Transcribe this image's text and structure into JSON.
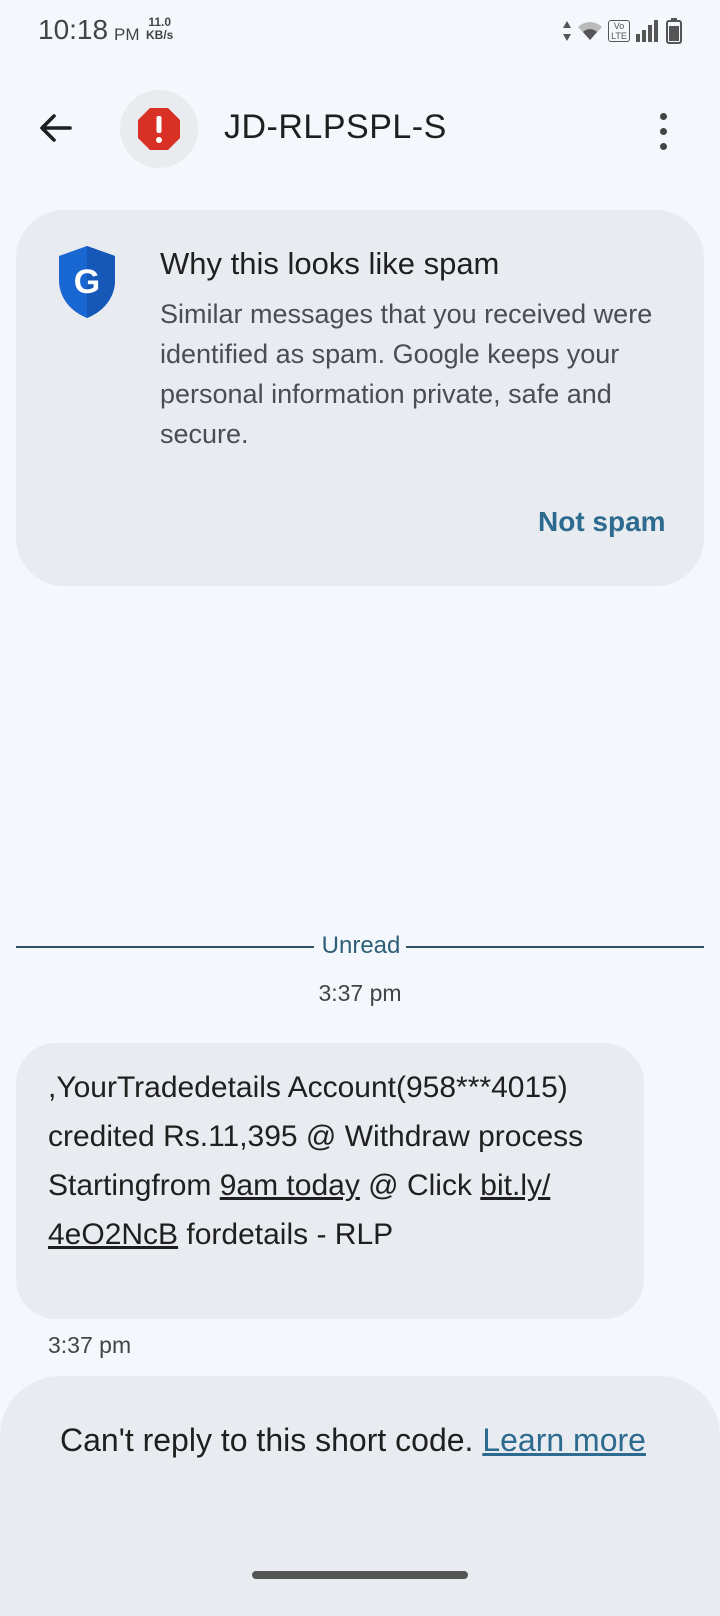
{
  "status_bar": {
    "time": "10:18",
    "ampm": "PM",
    "speed_value": "11.0",
    "speed_unit": "KB/s",
    "icons": [
      "data-arrows-icon",
      "wifi-icon",
      "volte-icon",
      "signal-icon",
      "battery-icon"
    ],
    "volte_label_top": "Vo",
    "volte_label_bottom": "LTE"
  },
  "header": {
    "contact_name": "JD-RLPSPL-S",
    "back_icon": "back-arrow-icon",
    "avatar_icon": "spam-alert-icon",
    "avatar_alert_color": "#d93025",
    "more_icon": "more-vert-icon"
  },
  "spam_card": {
    "title": "Why this looks like spam",
    "body": "Similar messages that you received were identified as spam. Google keeps your personal information private, safe and secure.",
    "shield_icon": "google-shield-icon",
    "shield_letter": "G",
    "shield_color": "#1967d2",
    "not_spam_label": "Not spam"
  },
  "conversation": {
    "unread_label": "Unread",
    "timestamp_header": "3:37 pm",
    "message": {
      "part1": ",YourTradedetails Account(958***4015) credited Rs.11,395 @ Withdraw process Startingfrom ",
      "link1": "9am today",
      "part2": " @ Click ",
      "link2": "bit.ly/\n4eO2NcB",
      "part3": " fordetails - RLP",
      "time": "3:37 pm"
    }
  },
  "footer": {
    "reply_text": "Can't reply to this short code. ",
    "learn_more": "Learn more"
  },
  "colors": {
    "accent_link": "#2d6a90",
    "background": "#f4f8fc",
    "card": "#e8ebef"
  }
}
